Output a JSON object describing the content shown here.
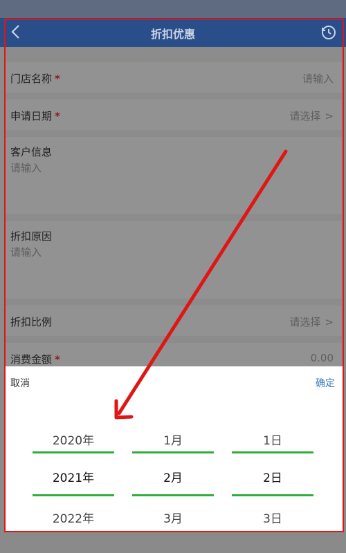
{
  "header": {
    "title": "折扣优惠"
  },
  "form": {
    "store_name": {
      "label": "门店名称",
      "required": "*",
      "placeholder": "请输入"
    },
    "apply_date": {
      "label": "申请日期",
      "required": "*",
      "placeholder": "请选择",
      "chevron": ">"
    },
    "customer_info": {
      "label": "客户信息",
      "placeholder": "请输入"
    },
    "discount_reason": {
      "label": "折扣原因",
      "placeholder": "请输入"
    },
    "discount_ratio": {
      "label": "折扣比例",
      "placeholder": "请选择",
      "chevron": ">"
    },
    "amount": {
      "label": "消费金额",
      "required": "*",
      "value": "0.00"
    }
  },
  "picker": {
    "cancel_label": "取消",
    "confirm_label": "确定",
    "years": [
      "2020年",
      "2021年",
      "2022年"
    ],
    "months": [
      "1月",
      "2月",
      "3月"
    ],
    "days": [
      "1日",
      "2日",
      "3日"
    ],
    "selected_index": 1
  },
  "colors": {
    "header_bg": "#2a4e8a",
    "accent_green": "#2fae3a",
    "confirm_blue": "#3a7bbd",
    "annotation_red": "#e01515"
  }
}
